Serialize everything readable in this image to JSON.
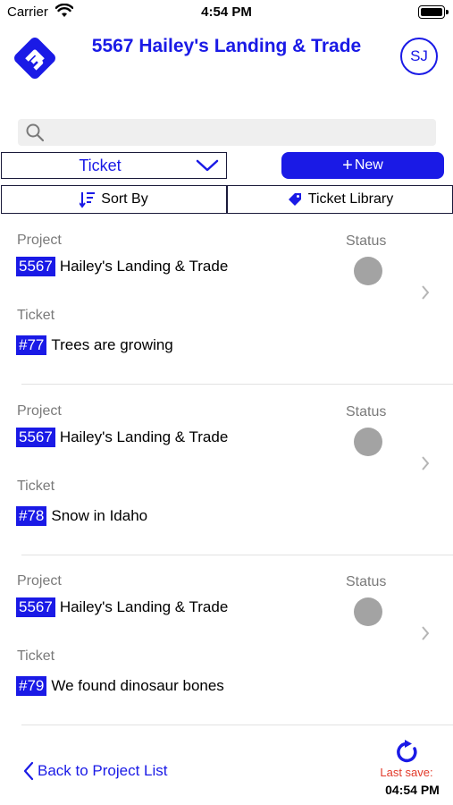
{
  "status_bar": {
    "carrier": "Carrier",
    "time": "4:54 PM"
  },
  "header": {
    "title": "5567 Hailey's Landing & Trade",
    "user_initials": "SJ"
  },
  "colors": {
    "accent": "#1a1ae6",
    "status_dot": "#a3a3a3",
    "last_save": "#e23a2a"
  },
  "search": {
    "placeholder": "",
    "value": ""
  },
  "type_select": {
    "value": "Ticket"
  },
  "buttons": {
    "new_label": "New",
    "sort_label": "Sort By",
    "library_label": "Ticket Library"
  },
  "labels": {
    "project": "Project",
    "status": "Status",
    "ticket": "Ticket"
  },
  "tickets": [
    {
      "project_number": "5567",
      "project_name": "Hailey's Landing & Trade",
      "ticket_number": "#77",
      "ticket_title": "Trees are growing"
    },
    {
      "project_number": "5567",
      "project_name": "Hailey's Landing & Trade",
      "ticket_number": "#78",
      "ticket_title": "Snow in Idaho"
    },
    {
      "project_number": "5567",
      "project_name": "Hailey's Landing & Trade",
      "ticket_number": "#79",
      "ticket_title": "We found dinosaur bones"
    }
  ],
  "footer": {
    "back_label": "Back to Project List",
    "last_save_label": "Last save:",
    "last_save_time": "04:54 PM"
  }
}
